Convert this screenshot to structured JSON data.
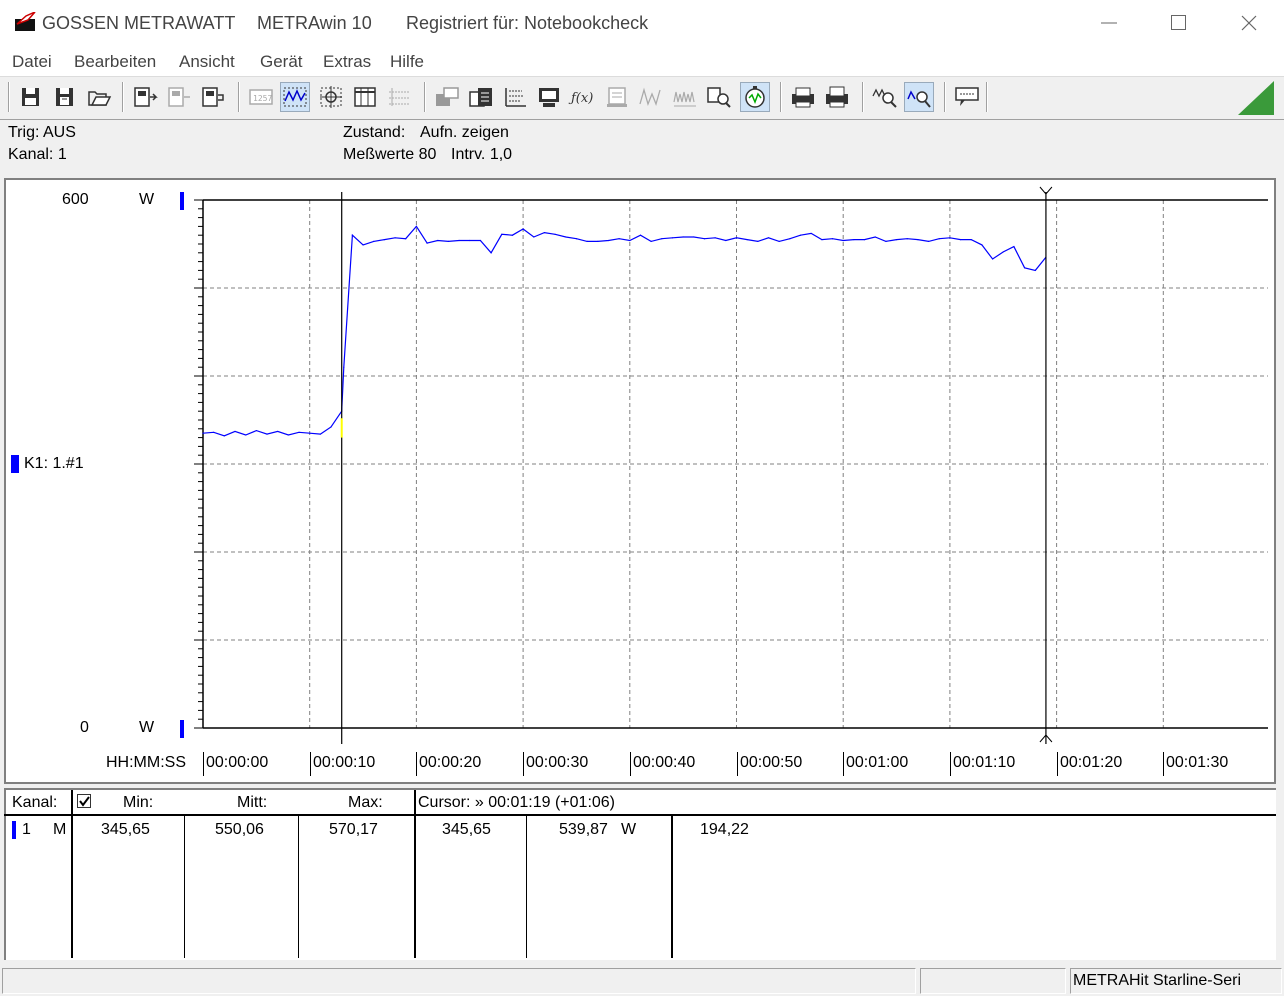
{
  "window": {
    "brand": "GOSSEN METRAWATT",
    "app": "METRAwin 10",
    "registered": "Registriert für: Notebookcheck"
  },
  "menu": [
    "Datei",
    "Bearbeiten",
    "Ansicht",
    "Gerät",
    "Extras",
    "Hilfe"
  ],
  "toolbar_icons": [
    "save-icon",
    "save-as-icon",
    "open-icon",
    "device-read-icon",
    "device-write-icon",
    "device-config-icon",
    "numeric-display-icon",
    "waveform-display-icon",
    "cursor-display-icon",
    "table-display-icon",
    "list-display-icon",
    "export-icon",
    "import-icon",
    "statistics-icon",
    "monitor-icon",
    "formula-icon",
    "memory-icon",
    "pulse-icon",
    "waveform-icon",
    "find-icon",
    "trigger-icon",
    "print-preview-icon",
    "print-icon",
    "zoom-wave-icon",
    "zoom-cursor-icon",
    "comment-icon"
  ],
  "info": {
    "trig": "Trig: AUS",
    "kanal": "Kanal: 1",
    "zustand_label": "Zustand:",
    "zustand_value": "Aufn. zeigen",
    "messwerte": "Meßwerte 80",
    "intervall": "Intrv. 1,0"
  },
  "chart": {
    "y_max_label": "600",
    "y_min_label": "0",
    "y_unit": "W",
    "channel_label": "K1: 1.#1",
    "x_axis_label": "HH:MM:SS",
    "x_tick_labels": [
      "00:00:00",
      "00:00:10",
      "00:00:20",
      "00:00:30",
      "00:00:40",
      "00:00:50",
      "00:01:00",
      "00:01:10",
      "00:01:20",
      "00:01:30"
    ],
    "line_color": "#0000ff"
  },
  "chart_data": {
    "type": "line",
    "x_unit": "s",
    "xlim": [
      0,
      100
    ],
    "ylim": [
      0,
      600
    ],
    "ylabel": "W",
    "xlabel": "HH:MM:SS",
    "grid": true,
    "cursors_s": [
      13,
      79
    ],
    "series": [
      {
        "name": "K1: 1.#1",
        "x": [
          0,
          1,
          2,
          3,
          4,
          5,
          6,
          7,
          8,
          9,
          10,
          11,
          12,
          13,
          13.2,
          14,
          15,
          16,
          17,
          18,
          19,
          20,
          21,
          22,
          23,
          24,
          25,
          26,
          27,
          28,
          29,
          30,
          31,
          32,
          33,
          34,
          35,
          36,
          37,
          38,
          39,
          40,
          41,
          42,
          43,
          44,
          45,
          46,
          47,
          48,
          49,
          50,
          51,
          52,
          53,
          54,
          55,
          56,
          57,
          58,
          59,
          60,
          61,
          62,
          63,
          64,
          65,
          66,
          67,
          68,
          69,
          70,
          71,
          72,
          73,
          74,
          75,
          76,
          77,
          78,
          79
        ],
        "y": [
          335,
          336,
          332,
          337,
          333,
          338,
          334,
          337,
          333,
          336,
          335,
          334,
          342,
          360,
          410,
          560,
          549,
          553,
          555,
          557,
          556,
          570,
          551,
          554,
          553,
          554,
          554,
          554,
          540,
          561,
          560,
          567,
          558,
          563,
          561,
          558,
          556,
          553,
          553,
          554,
          556,
          554,
          560,
          553,
          556,
          557,
          558,
          558,
          556,
          557,
          554,
          557,
          555,
          553,
          557,
          553,
          556,
          560,
          562,
          555,
          556,
          554,
          555,
          555,
          558,
          553,
          555,
          556,
          555,
          553,
          556,
          557,
          555,
          555,
          549,
          533,
          541,
          547,
          523,
          520,
          535
        ]
      }
    ]
  },
  "table": {
    "headers": {
      "kanal": "Kanal:",
      "min": "Min:",
      "mitt": "Mitt:",
      "max": "Max:",
      "cursor": "Cursor: » 00:01:19 (+01:06)"
    },
    "row": {
      "channel": "1",
      "mode": "M",
      "min": "345,65",
      "mitt": "550,06",
      "max": "570,17",
      "cursor1": "345,65",
      "cursor2": "539,87",
      "unit": "W",
      "diff": "194,22"
    }
  },
  "statusbar": {
    "device": "METRAHit Starline-Seri"
  }
}
